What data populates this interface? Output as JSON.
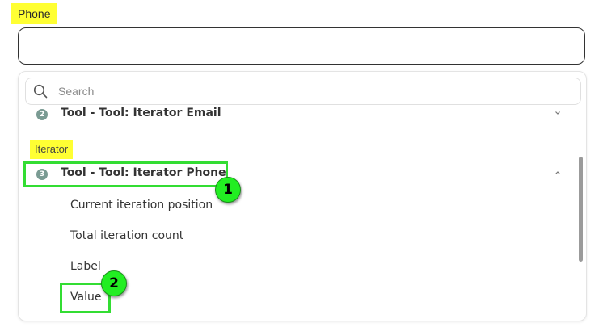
{
  "field": {
    "label": "Phone",
    "value": "",
    "placeholder": ""
  },
  "dropdown": {
    "search": {
      "placeholder": "Search",
      "icon": "search-icon"
    },
    "groups": [
      {
        "step": "2",
        "title": "Tool - Tool: Iterator Email",
        "expanded": false,
        "chevron": "chevron-down-icon"
      },
      {
        "step": "3",
        "title": "Tool - Tool: Iterator Phone",
        "expanded": true,
        "chevron": "chevron-up-icon"
      }
    ],
    "section_label": "Iterator",
    "sub_items": [
      {
        "label": "Current iteration position"
      },
      {
        "label": "Total iteration count"
      },
      {
        "label": "Label"
      },
      {
        "label": "Value"
      }
    ]
  },
  "annotations": [
    {
      "number": "1"
    },
    {
      "number": "2"
    }
  ],
  "colors": {
    "highlight": "#ffff33",
    "annotation": "#33dd33",
    "step_badge": "#7a9b93"
  }
}
